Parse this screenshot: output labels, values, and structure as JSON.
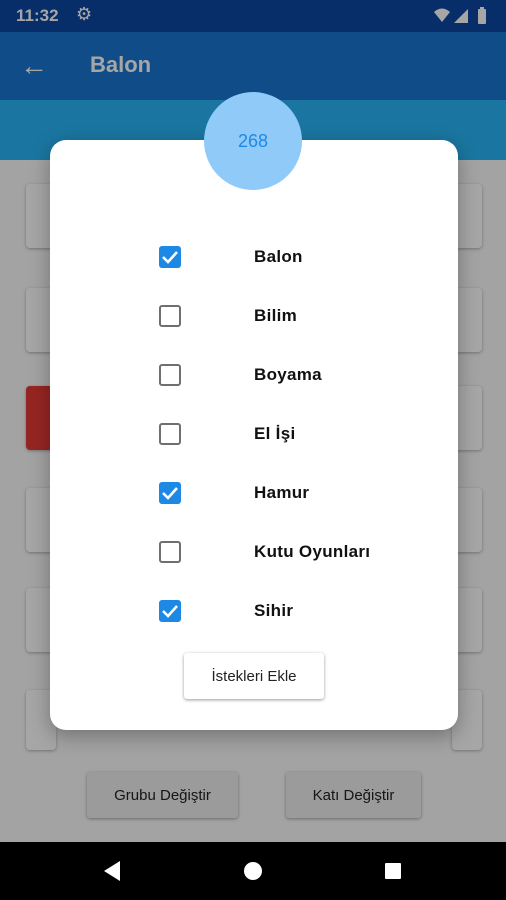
{
  "status_bar": {
    "time": "11:32"
  },
  "app_bar": {
    "title": "Balon"
  },
  "bottom_buttons": {
    "change_group": "Grubu Değiştir",
    "change_floor": "Katı Değiştir"
  },
  "dialog": {
    "count": "268",
    "categories": [
      {
        "label": "Balon",
        "checked": true
      },
      {
        "label": "Bilim",
        "checked": false
      },
      {
        "label": "Boyama",
        "checked": false
      },
      {
        "label": "El İşi",
        "checked": false
      },
      {
        "label": "Hamur",
        "checked": true
      },
      {
        "label": "Kutu Oyunları",
        "checked": false
      },
      {
        "label": "Sihir",
        "checked": true
      }
    ],
    "add_button": "İstekleri Ekle"
  },
  "colors": {
    "status_bar": "#0d47a1",
    "app_bar": "#1976d2",
    "checkbox_checked": "#1e88e5",
    "count_circle": "#90caf9"
  }
}
